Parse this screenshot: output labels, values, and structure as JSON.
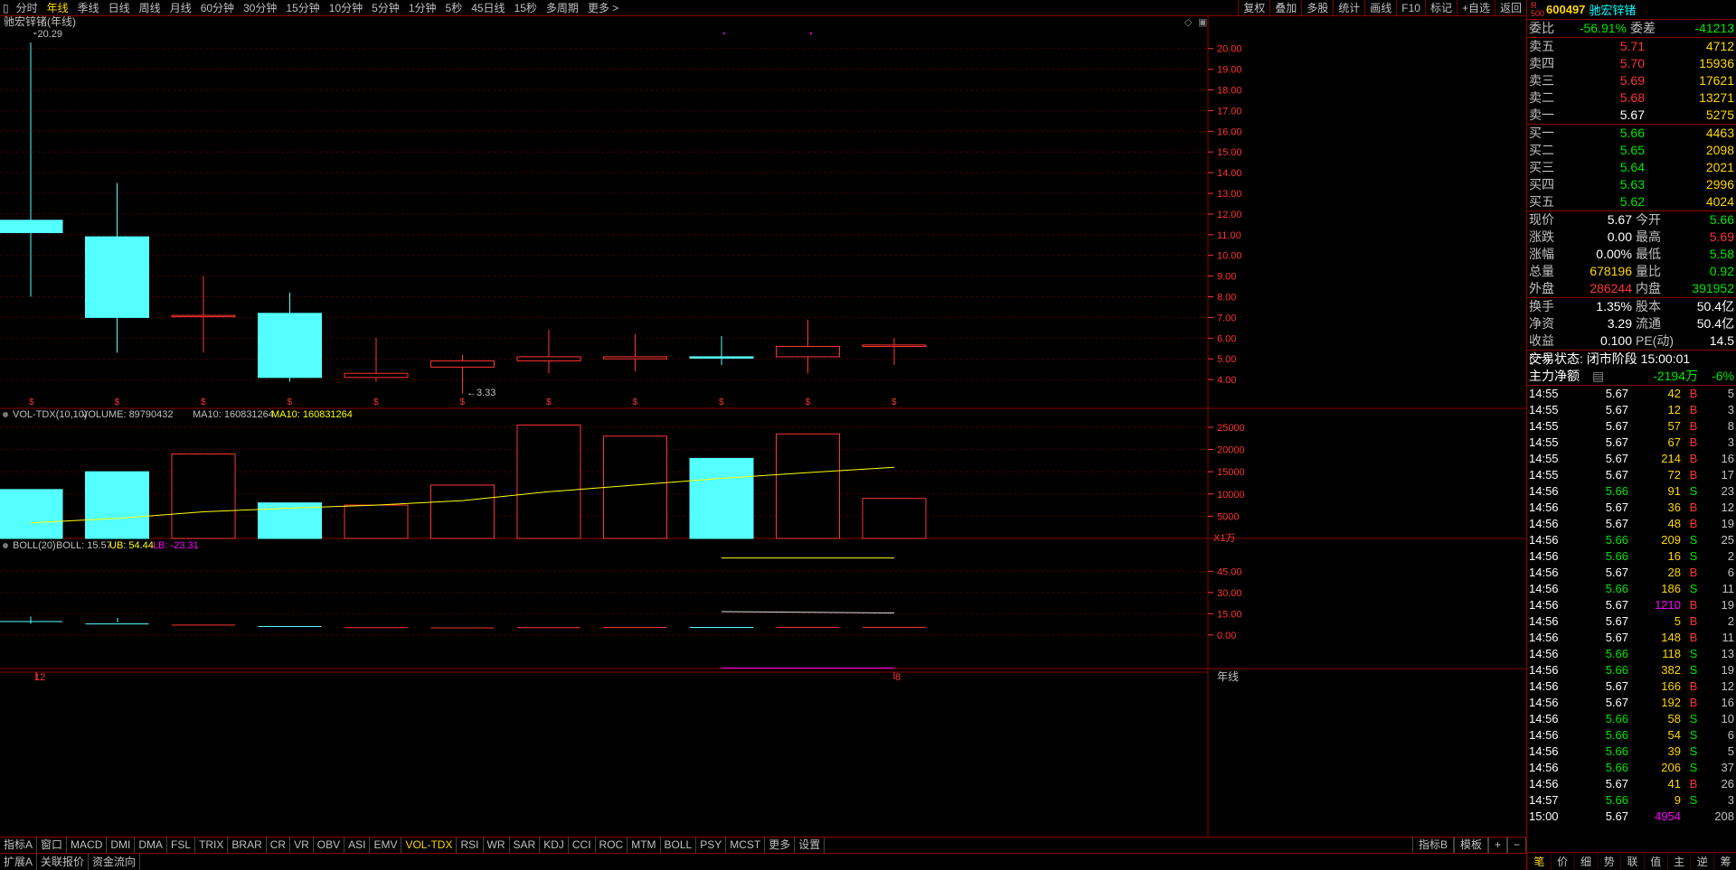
{
  "toolbar": {
    "periods": [
      "分时",
      "年线",
      "季线",
      "日线",
      "周线",
      "月线",
      "60分钟",
      "30分钟",
      "15分钟",
      "10分钟",
      "5分钟",
      "1分钟",
      "5秒",
      "45日线",
      "15秒",
      "多周期",
      "更多 >"
    ],
    "active_period": "年线",
    "right": [
      "复权",
      "叠加",
      "多股",
      "统计",
      "画线",
      "F10",
      "标记",
      "+自选",
      "返回"
    ]
  },
  "main_chart": {
    "title": "驰宏锌锗(年线)",
    "high_label": "20.29",
    "low_label": "3.33",
    "y_ticks": [
      "20.00",
      "19.00",
      "18.00",
      "17.00",
      "16.00",
      "15.00",
      "14.00",
      "13.00",
      "12.00",
      "11.00",
      "10.00",
      "9.00",
      "8.00",
      "7.00",
      "6.00",
      "5.00",
      "4.00"
    ]
  },
  "vol_panel": {
    "name": "VOL-TDX(10,10)",
    "volume": "VOLUME: 89790432",
    "ma10a": "MA10: 160831264",
    "ma10b": "MA10: 160831264",
    "y_ticks": [
      "25000",
      "20000",
      "15000",
      "10000",
      "5000"
    ],
    "unit": "X1万"
  },
  "boll_panel": {
    "name": "BOLL(20)",
    "boll": "BOLL: 15.57",
    "ub": "UB: 54.44",
    "lb": "LB: -23.31",
    "y_ticks": [
      "45.00",
      "30.00",
      "15.00",
      "0.00"
    ]
  },
  "axis": {
    "left_label": "12",
    "right_label": "8",
    "period_label": "年线"
  },
  "chart_data": {
    "type": "candlestick",
    "candles": [
      {
        "open": 11.1,
        "close": 11.7,
        "high": 20.29,
        "low": 8.0,
        "up": false
      },
      {
        "open": 10.9,
        "close": 7.0,
        "high": 13.5,
        "low": 5.3,
        "up": false
      },
      {
        "open": 7.1,
        "close": 7.1,
        "high": 9.0,
        "low": 5.3,
        "up": true
      },
      {
        "open": 7.2,
        "close": 4.1,
        "high": 8.2,
        "low": 3.9,
        "up": false
      },
      {
        "open": 4.1,
        "close": 4.3,
        "high": 6.0,
        "low": 3.9,
        "up": true
      },
      {
        "open": 4.6,
        "close": 4.9,
        "high": 5.2,
        "low": 3.33,
        "up": true
      },
      {
        "open": 4.9,
        "close": 5.1,
        "high": 6.4,
        "low": 4.3,
        "up": true
      },
      {
        "open": 5.0,
        "close": 5.1,
        "high": 6.2,
        "low": 4.4,
        "up": true
      },
      {
        "open": 5.1,
        "close": 5.1,
        "high": 6.1,
        "low": 4.7,
        "up": false
      },
      {
        "open": 5.1,
        "close": 5.6,
        "high": 6.9,
        "low": 4.3,
        "up": true
      },
      {
        "open": 5.6,
        "close": 5.67,
        "high": 6.0,
        "low": 4.7,
        "up": true
      }
    ],
    "volume": [
      11000,
      15000,
      19000,
      8000,
      7500,
      12000,
      25500,
      23000,
      18000,
      23500,
      9000
    ],
    "vol_ma10": [
      3500,
      4500,
      6000,
      6800,
      7500,
      8500,
      10500,
      12000,
      13500,
      14800,
      16000
    ],
    "boll": {
      "mid": [
        9.5,
        7.8,
        7.0,
        6.0,
        5.2,
        5.0,
        5.2,
        5.3,
        5.3,
        5.4,
        5.4
      ],
      "ub": [
        null,
        null,
        null,
        null,
        null,
        null,
        null,
        null,
        54.44,
        54.44,
        54.44
      ],
      "lb": [
        null,
        null,
        null,
        null,
        null,
        null,
        null,
        null,
        -23.31,
        -23.31,
        -23.31
      ],
      "boll_line": [
        null,
        null,
        null,
        null,
        null,
        null,
        null,
        null,
        16.5,
        16.0,
        15.57
      ]
    },
    "ylim_price": [
      3.0,
      20.6
    ],
    "ylim_vol": [
      0,
      26000
    ],
    "ylim_boll": [
      -25,
      58
    ]
  },
  "sidebar": {
    "code": "600497",
    "name": "驰宏锌锗",
    "weibi": {
      "label": "委比",
      "value": "-56.91%",
      "label2": "委差",
      "value2": "-41213"
    },
    "sell": [
      {
        "label": "卖五",
        "price": "5.71",
        "vol": "4712"
      },
      {
        "label": "卖四",
        "price": "5.70",
        "vol": "15936"
      },
      {
        "label": "卖三",
        "price": "5.69",
        "vol": "17621"
      },
      {
        "label": "卖二",
        "price": "5.68",
        "vol": "13271"
      },
      {
        "label": "卖一",
        "price": "5.67",
        "vol": "5275"
      }
    ],
    "buy": [
      {
        "label": "买一",
        "price": "5.66",
        "vol": "4463"
      },
      {
        "label": "买二",
        "price": "5.65",
        "vol": "2098"
      },
      {
        "label": "买三",
        "price": "5.64",
        "vol": "2021"
      },
      {
        "label": "买四",
        "price": "5.63",
        "vol": "2996"
      },
      {
        "label": "买五",
        "price": "5.62",
        "vol": "4024"
      }
    ],
    "quote": [
      {
        "l": "现价",
        "v": "5.67",
        "c": "white",
        "l2": "今开",
        "v2": "5.66",
        "c2": "green"
      },
      {
        "l": "涨跌",
        "v": "0.00",
        "c": "white",
        "l2": "最高",
        "v2": "5.69",
        "c2": "red"
      },
      {
        "l": "涨幅",
        "v": "0.00%",
        "c": "white",
        "l2": "最低",
        "v2": "5.58",
        "c2": "green"
      },
      {
        "l": "总量",
        "v": "678196",
        "c": "yellow",
        "l2": "量比",
        "v2": "0.92",
        "c2": "green"
      },
      {
        "l": "外盘",
        "v": "286244",
        "c": "red",
        "l2": "内盘",
        "v2": "391952",
        "c2": "green"
      }
    ],
    "fund": [
      {
        "l": "换手",
        "v": "1.35%",
        "l2": "股本",
        "v2": "50.4亿"
      },
      {
        "l": "净资",
        "v": "3.29",
        "l2": "流通",
        "v2": "50.4亿"
      },
      {
        "l": "收益(一)",
        "v": "0.100",
        "l2": "PE(动)",
        "v2": "14.5"
      }
    ],
    "status": "交易状态: 闭市阶段 15:00:01",
    "main_flow_label": "主力净额",
    "main_flow_value": "-2194万",
    "main_flow_pct": "-6%",
    "ticks": [
      {
        "t": "14:55",
        "p": "5.67",
        "pc": "white",
        "q": "42",
        "qc": "yellow",
        "bs": "B",
        "n": "5"
      },
      {
        "t": "14:55",
        "p": "5.67",
        "pc": "white",
        "q": "12",
        "qc": "yellow",
        "bs": "B",
        "n": "3"
      },
      {
        "t": "14:55",
        "p": "5.67",
        "pc": "white",
        "q": "57",
        "qc": "yellow",
        "bs": "B",
        "n": "8"
      },
      {
        "t": "14:55",
        "p": "5.67",
        "pc": "white",
        "q": "67",
        "qc": "yellow",
        "bs": "B",
        "n": "3"
      },
      {
        "t": "14:55",
        "p": "5.67",
        "pc": "white",
        "q": "214",
        "qc": "yellow",
        "bs": "B",
        "n": "16"
      },
      {
        "t": "14:55",
        "p": "5.67",
        "pc": "white",
        "q": "72",
        "qc": "yellow",
        "bs": "B",
        "n": "17"
      },
      {
        "t": "14:56",
        "p": "5.66",
        "pc": "green",
        "q": "91",
        "qc": "yellow",
        "bs": "S",
        "n": "23"
      },
      {
        "t": "14:56",
        "p": "5.67",
        "pc": "white",
        "q": "36",
        "qc": "yellow",
        "bs": "B",
        "n": "12"
      },
      {
        "t": "14:56",
        "p": "5.67",
        "pc": "white",
        "q": "48",
        "qc": "yellow",
        "bs": "B",
        "n": "19"
      },
      {
        "t": "14:56",
        "p": "5.66",
        "pc": "green",
        "q": "209",
        "qc": "yellow",
        "bs": "S",
        "n": "25"
      },
      {
        "t": "14:56",
        "p": "5.66",
        "pc": "green",
        "q": "16",
        "qc": "yellow",
        "bs": "S",
        "n": "2"
      },
      {
        "t": "14:56",
        "p": "5.67",
        "pc": "white",
        "q": "28",
        "qc": "yellow",
        "bs": "B",
        "n": "6"
      },
      {
        "t": "14:56",
        "p": "5.66",
        "pc": "green",
        "q": "186",
        "qc": "yellow",
        "bs": "S",
        "n": "11"
      },
      {
        "t": "14:56",
        "p": "5.67",
        "pc": "white",
        "q": "1210",
        "qc": "magenta",
        "bs": "B",
        "n": "19"
      },
      {
        "t": "14:56",
        "p": "5.67",
        "pc": "white",
        "q": "5",
        "qc": "yellow",
        "bs": "B",
        "n": "2"
      },
      {
        "t": "14:56",
        "p": "5.67",
        "pc": "white",
        "q": "148",
        "qc": "yellow",
        "bs": "B",
        "n": "11"
      },
      {
        "t": "14:56",
        "p": "5.66",
        "pc": "green",
        "q": "118",
        "qc": "yellow",
        "bs": "S",
        "n": "13"
      },
      {
        "t": "14:56",
        "p": "5.66",
        "pc": "green",
        "q": "382",
        "qc": "yellow",
        "bs": "S",
        "n": "19"
      },
      {
        "t": "14:56",
        "p": "5.67",
        "pc": "white",
        "q": "166",
        "qc": "yellow",
        "bs": "B",
        "n": "12"
      },
      {
        "t": "14:56",
        "p": "5.67",
        "pc": "white",
        "q": "192",
        "qc": "yellow",
        "bs": "B",
        "n": "16"
      },
      {
        "t": "14:56",
        "p": "5.66",
        "pc": "green",
        "q": "58",
        "qc": "yellow",
        "bs": "S",
        "n": "10"
      },
      {
        "t": "14:56",
        "p": "5.66",
        "pc": "green",
        "q": "54",
        "qc": "yellow",
        "bs": "S",
        "n": "6"
      },
      {
        "t": "14:56",
        "p": "5.66",
        "pc": "green",
        "q": "39",
        "qc": "yellow",
        "bs": "S",
        "n": "5"
      },
      {
        "t": "14:56",
        "p": "5.66",
        "pc": "green",
        "q": "206",
        "qc": "yellow",
        "bs": "S",
        "n": "37"
      },
      {
        "t": "14:56",
        "p": "5.67",
        "pc": "white",
        "q": "41",
        "qc": "yellow",
        "bs": "B",
        "n": "26"
      },
      {
        "t": "14:57",
        "p": "5.66",
        "pc": "green",
        "q": "9",
        "qc": "yellow",
        "bs": "S",
        "n": "3"
      },
      {
        "t": "15:00",
        "p": "5.67",
        "pc": "white",
        "q": "4954",
        "qc": "magenta",
        "bs": "",
        "n": "208"
      }
    ],
    "bottom_tabs": [
      "笔",
      "价",
      "细",
      "势",
      "联",
      "值",
      "主",
      "逆",
      "筹"
    ]
  },
  "bottom1": {
    "tabs": [
      "指标A",
      "窗口",
      "MACD",
      "DMI",
      "DMA",
      "FSL",
      "TRIX",
      "BRAR",
      "CR",
      "VR",
      "OBV",
      "ASI",
      "EMV",
      "VOL-TDX",
      "RSI",
      "WR",
      "SAR",
      "KDJ",
      "CCI",
      "ROC",
      "MTM",
      "BOLL",
      "PSY",
      "MCST",
      "更多",
      "设置"
    ],
    "active": "VOL-TDX",
    "right": [
      "指标B",
      "模板",
      "+",
      "−"
    ]
  },
  "bottom2": {
    "tabs": [
      "扩展A",
      "关联报价",
      "资金流向"
    ]
  },
  "colors": {
    "up": "#ff3333",
    "down": "#54ffff",
    "grid": "#8b0000",
    "ma": "#ffff00"
  }
}
